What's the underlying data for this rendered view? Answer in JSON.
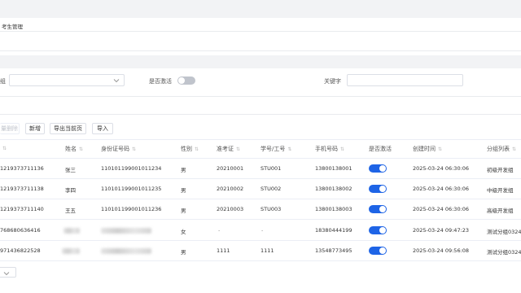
{
  "breadcrumb": {
    "title": "考生管理"
  },
  "filters": {
    "group_label_partial": "组",
    "group_select_value": "",
    "active_label": "是否激活",
    "keyword_label": "关键字",
    "keyword_value": ""
  },
  "toolbar": {
    "delete_partial_label": "量删除",
    "add_label": "新增",
    "export_label": "导出当前页",
    "import_label": "导入"
  },
  "table": {
    "columns": [
      "姓名",
      "身份证号码",
      "性别",
      "准考证",
      "学号/工号",
      "手机号码",
      "是否激活",
      "创建时间",
      "分组列表"
    ],
    "rows": [
      {
        "id_partial": "1219373711136",
        "name": "张三",
        "id_number": "110101199001011234",
        "gender": "男",
        "exam_no": "20210001",
        "student_no": "STU001",
        "phone": "13800138001",
        "active": true,
        "created": "2025-03-24 06:30:06",
        "group": "初级开发组"
      },
      {
        "id_partial": "1219373711138",
        "name": "李四",
        "id_number": "110101199001011235",
        "gender": "男",
        "exam_no": "20210002",
        "student_no": "STU002",
        "phone": "13800138002",
        "active": true,
        "created": "2025-03-24 06:30:06",
        "group": "中级开发组"
      },
      {
        "id_partial": "1219373711140",
        "name": "王五",
        "id_number": "110101199001011236",
        "gender": "男",
        "exam_no": "20210003",
        "student_no": "STU003",
        "phone": "13800138003",
        "active": true,
        "created": "2025-03-24 06:30:06",
        "group": "高级开发组"
      },
      {
        "id_partial": "768680636416",
        "name": "",
        "id_number": "",
        "gender": "女",
        "exam_no": "-",
        "student_no": "-",
        "phone": "18380444199",
        "active": true,
        "created": "2025-03-24 09:47:23",
        "group": "测试分组0324"
      },
      {
        "id_partial": "971436822528",
        "name": "",
        "id_number": "",
        "gender": "男",
        "exam_no": "1111",
        "student_no": "1111",
        "phone": "13548773495",
        "active": true,
        "created": "2025-03-24 09:56:08",
        "group": "测试分组0324"
      }
    ]
  },
  "colors": {
    "accent": "#1e64e6",
    "border": "#dcdfe6",
    "band": "#f2f3f5"
  }
}
